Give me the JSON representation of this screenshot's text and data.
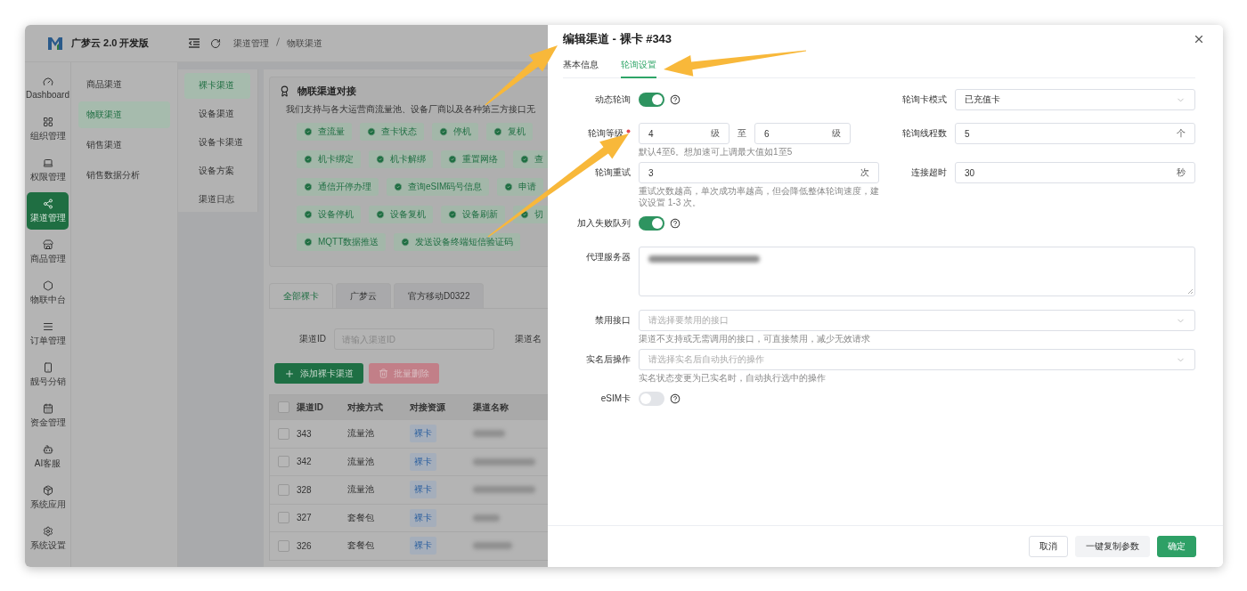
{
  "app": {
    "brand": "广梦云 2.0 开发版",
    "breadcrumb": [
      "渠道管理",
      "物联渠道"
    ]
  },
  "rail": [
    {
      "label": "Dashboard",
      "selected": false
    },
    {
      "label": "组织管理",
      "selected": false
    },
    {
      "label": "权限管理",
      "selected": false
    },
    {
      "label": "渠道管理",
      "selected": true
    },
    {
      "label": "商品管理",
      "selected": false
    },
    {
      "label": "物联中台",
      "selected": false
    },
    {
      "label": "订单管理",
      "selected": false
    },
    {
      "label": "靓号分销",
      "selected": false
    },
    {
      "label": "资金管理",
      "selected": false
    },
    {
      "label": "AI客服",
      "selected": false
    },
    {
      "label": "系统应用",
      "selected": false
    },
    {
      "label": "系统设置",
      "selected": false
    }
  ],
  "menu": [
    {
      "label": "商品渠道",
      "selected": false
    },
    {
      "label": "物联渠道",
      "selected": true
    },
    {
      "label": "销售渠道",
      "selected": false
    },
    {
      "label": "销售数据分析",
      "selected": false
    }
  ],
  "submenu": [
    {
      "label": "裸卡渠道",
      "selected": true
    },
    {
      "label": "设备渠道",
      "selected": false
    },
    {
      "label": "设备卡渠道",
      "selected": false
    },
    {
      "label": "设备方案",
      "selected": false
    },
    {
      "label": "渠道日志",
      "selected": false
    }
  ],
  "intro": {
    "title": "物联渠道对接",
    "text": "我们支持与各大运营商流量池、设备厂商以及各种第三方接口无",
    "tag_rows": [
      [
        "查流量",
        "查卡状态",
        "停机",
        "复机"
      ],
      [
        "机卡绑定",
        "机卡解绑",
        "重置网络",
        "查"
      ],
      [
        "通信开停办理",
        "查询eSIM码号信息",
        "申请"
      ],
      [
        "设备停机",
        "设备复机",
        "设备刷新",
        "切"
      ],
      [
        "MQTT数据推送",
        "发送设备终端短信验证码"
      ]
    ]
  },
  "filter_tabs": [
    {
      "label": "全部裸卡",
      "selected": true
    },
    {
      "label": "广梦云",
      "selected": false
    },
    {
      "label": "官方移动D0322",
      "selected": false
    }
  ],
  "search": {
    "label": "渠道ID",
    "placeholder": "请输入渠道ID",
    "label_2": "渠道名"
  },
  "actions": [
    {
      "label": "添加裸卡渠道",
      "kind": "primary"
    },
    {
      "label": "批量删除",
      "kind": "danger"
    }
  ],
  "table": {
    "columns": [
      "渠道ID",
      "对接方式",
      "对接资源",
      "渠道名称"
    ],
    "header_checked": false,
    "rows": [
      {
        "id": "343",
        "method": "流量池",
        "resource": "裸卡",
        "checked": false
      },
      {
        "id": "342",
        "method": "流量池",
        "resource": "裸卡",
        "checked": false
      },
      {
        "id": "328",
        "method": "流量池",
        "resource": "裸卡",
        "checked": false
      },
      {
        "id": "327",
        "method": "套餐包",
        "resource": "裸卡",
        "checked": false
      },
      {
        "id": "326",
        "method": "套餐包",
        "resource": "裸卡",
        "checked": false
      }
    ]
  },
  "drawer": {
    "title": "编辑渠道 - 裸卡 #343",
    "tabs": [
      {
        "label": "基本信息",
        "selected": false
      },
      {
        "label": "轮询设置",
        "selected": true
      }
    ],
    "left_fields": [
      {
        "kind": "switch",
        "label": "动态轮询",
        "on": true
      },
      {
        "kind": "range",
        "label": "轮询等级",
        "required": true,
        "from": "4",
        "from_unit": "级",
        "separator": "至",
        "to": "6",
        "to_unit": "级",
        "hint": "默认4至6。想加速可上调最大值如1至5"
      },
      {
        "kind": "number",
        "label": "轮询重试",
        "value": "3",
        "unit": "次",
        "hint": "重试次数越高，单次成功率越高，但会降低整体轮询速度，建议设置 1-3 次。"
      },
      {
        "kind": "switch",
        "label": "加入失败队列",
        "on": true
      }
    ],
    "right_fields": [
      {
        "kind": "select",
        "label": "轮询卡模式",
        "value": "已充值卡"
      },
      {
        "kind": "number",
        "label": "轮询线程数",
        "value": "5",
        "unit": "个"
      },
      {
        "kind": "number",
        "label": "连接超时",
        "value": "30",
        "unit": "秒"
      }
    ],
    "full_fields": [
      {
        "kind": "textarea",
        "label": "代理服务器"
      },
      {
        "kind": "select",
        "label": "禁用接口",
        "placeholder": "请选择要禁用的接口",
        "hint": "渠道不支持或无需调用的接口，可直接禁用，减少无效请求"
      },
      {
        "kind": "select",
        "label": "实名后操作",
        "placeholder": "请选择实名后自动执行的操作",
        "hint": "实名状态变更为已实名时，自动执行选中的操作"
      },
      {
        "kind": "switch",
        "label": "eSIM卡",
        "on": false
      }
    ],
    "buttons": [
      {
        "label": "取消",
        "kind": "default"
      },
      {
        "label": "一键复制参数",
        "kind": "secondary"
      },
      {
        "label": "确定",
        "kind": "primary"
      }
    ]
  }
}
